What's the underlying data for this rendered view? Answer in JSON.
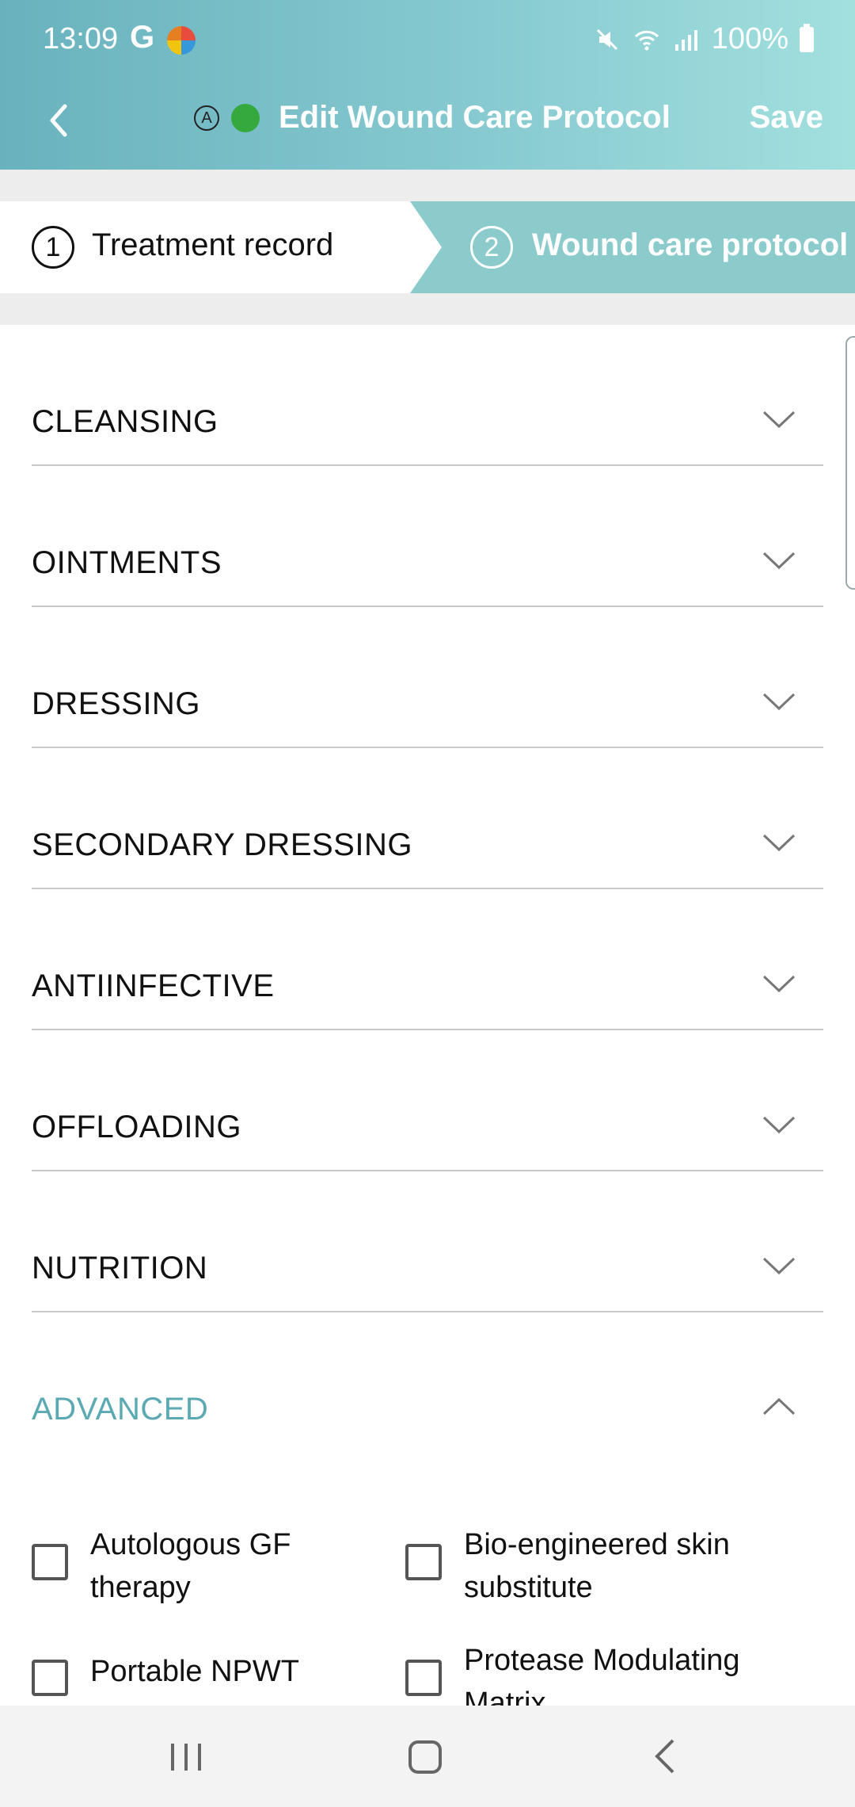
{
  "status_bar": {
    "time": "13:09",
    "google_letter": "G",
    "battery_percent": "100%"
  },
  "header": {
    "title": "Edit Wound Care Protocol",
    "save_label": "Save",
    "mode_badge": "A"
  },
  "stepper": [
    {
      "number": "1",
      "label": "Treatment record",
      "active": false
    },
    {
      "number": "2",
      "label": "Wound care protocol",
      "active": true
    }
  ],
  "sections": [
    {
      "label": "CLEANSING",
      "expanded": false
    },
    {
      "label": "OINTMENTS",
      "expanded": false
    },
    {
      "label": "DRESSING",
      "expanded": false
    },
    {
      "label": "SECONDARY DRESSING",
      "expanded": false
    },
    {
      "label": "ANTIINFECTIVE",
      "expanded": false
    },
    {
      "label": "OFFLOADING",
      "expanded": false
    },
    {
      "label": "NUTRITION",
      "expanded": false
    },
    {
      "label": "ADVANCED",
      "expanded": true
    }
  ],
  "advanced_options": [
    {
      "label": "Autologous GF therapy",
      "checked": false
    },
    {
      "label": "Bio-engineered skin substitute",
      "checked": false
    },
    {
      "label": "Portable NPWT",
      "checked": false
    },
    {
      "label": "Protease Modulating Matrix",
      "checked": false
    }
  ],
  "colors": {
    "accent": "#5aa9b3",
    "header_start": "#69b2bd",
    "header_end": "#a2e0de",
    "online": "#35a83e",
    "active_step": "#8ccbcc"
  }
}
